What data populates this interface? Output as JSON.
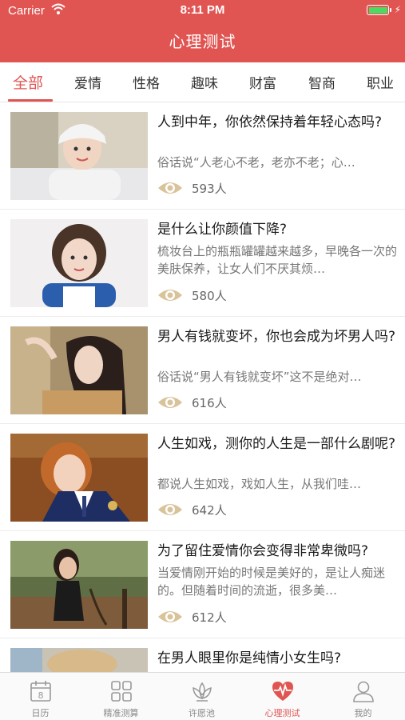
{
  "status_bar": {
    "carrier": "Carrier",
    "time": "8:11 PM"
  },
  "nav": {
    "title": "心理测试"
  },
  "colors": {
    "accent": "#e05552",
    "battery": "#4cd964",
    "eye_icon": "#d9c39a"
  },
  "categories": [
    {
      "label": "全部",
      "active": true
    },
    {
      "label": "爱情",
      "active": false
    },
    {
      "label": "性格",
      "active": false
    },
    {
      "label": "趣味",
      "active": false
    },
    {
      "label": "财富",
      "active": false
    },
    {
      "label": "智商",
      "active": false
    },
    {
      "label": "职业",
      "active": false
    }
  ],
  "articles": [
    {
      "title": "人到中年，你依然保持着年轻心态吗?",
      "desc": "俗话说“人老心不老，老亦不老；心…",
      "views": "593人",
      "icon": "eye-icon"
    },
    {
      "title": "是什么让你颜值下降?",
      "desc": "梳妆台上的瓶瓶罐罐越来越多，早晚各一次的美肤保养，让女人们不厌其烦…",
      "views": "580人",
      "icon": "eye-icon"
    },
    {
      "title": "男人有钱就变坏，你也会成为坏男人吗?",
      "desc": "俗话说“男人有钱就变坏”这不是绝对…",
      "views": "616人",
      "icon": "eye-icon"
    },
    {
      "title": "人生如戏，测你的人生是一部什么剧呢?",
      "desc": "都说人生如戏，戏如人生，从我们哇…",
      "views": "642人",
      "icon": "eye-icon"
    },
    {
      "title": "为了留住爱情你会变得非常卑微吗?",
      "desc": "当爱情刚开始的时候是美好的，是让人痴迷的。但随着时间的流逝，很多美…",
      "views": "612人",
      "icon": "eye-icon"
    },
    {
      "title": "在男人眼里你是纯情小女生吗?",
      "desc": "",
      "views": "",
      "icon": "eye-icon"
    }
  ],
  "bottom_tabs": [
    {
      "label": "日历",
      "icon": "calendar-icon",
      "badge": "8",
      "active": false
    },
    {
      "label": "精准测算",
      "icon": "grid-icon",
      "active": false
    },
    {
      "label": "许愿池",
      "icon": "lotus-icon",
      "active": false
    },
    {
      "label": "心理测试",
      "icon": "heart-pulse-icon",
      "active": true
    },
    {
      "label": "我的",
      "icon": "user-icon",
      "active": false
    }
  ]
}
